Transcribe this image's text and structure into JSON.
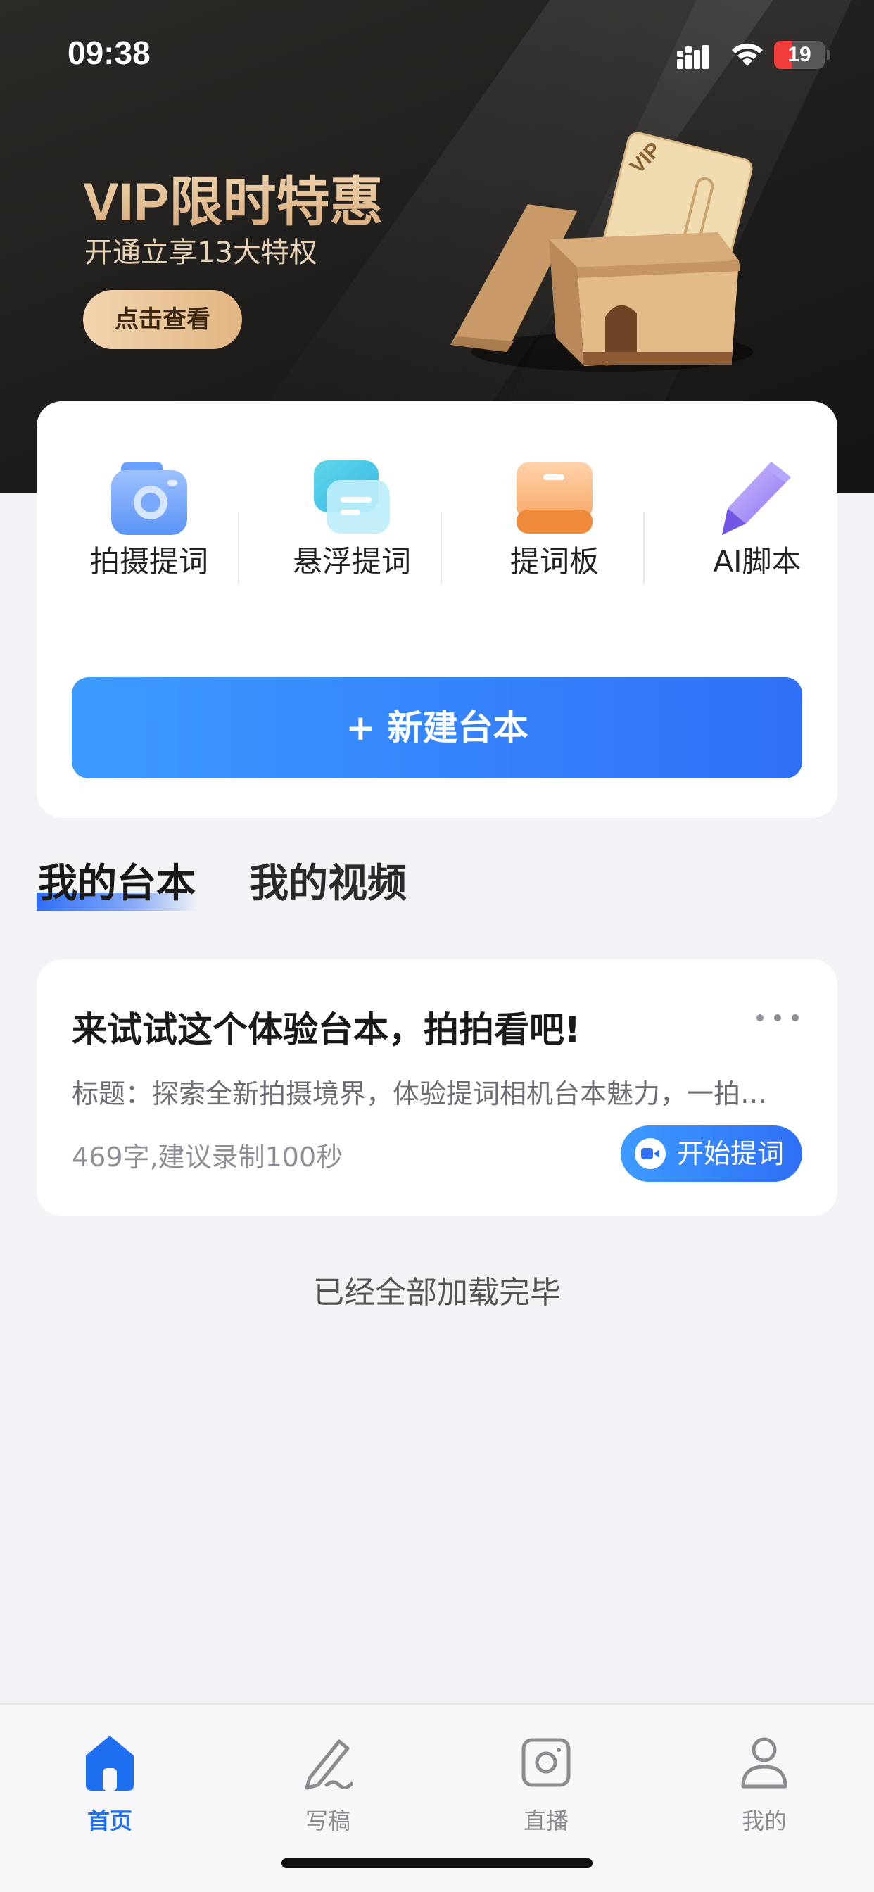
{
  "status_bar": {
    "time": "09:38",
    "battery": "19",
    "battery_level": 0.19
  },
  "promo": {
    "title": "VIP限时特惠",
    "subtitle": "开通立享13大特权",
    "button_label": "点击查看",
    "card_badge": "VIP"
  },
  "tools": [
    {
      "label": "拍摄提词",
      "icon": "camera-icon"
    },
    {
      "label": "悬浮提词",
      "icon": "floating-window-icon"
    },
    {
      "label": "提词板",
      "icon": "board-icon"
    },
    {
      "label": "AI脚本",
      "icon": "pen-icon"
    }
  ],
  "new_script_label": "+ 新建台本",
  "tabs": [
    {
      "label": "我的台本",
      "active": true
    },
    {
      "label": "我的视频",
      "active": false
    }
  ],
  "script": {
    "title": "来试试这个体验台本，拍拍看吧!",
    "description": "标题：探索全新拍摄境界，体验提词相机台本魅力，一拍即合！",
    "meta": "469字,建议录制100秒",
    "start_label": "开始提词"
  },
  "end_text": "已经全部加载完毕",
  "nav": [
    {
      "label": "首页",
      "icon": "home-icon",
      "active": true
    },
    {
      "label": "写稿",
      "icon": "write-icon",
      "active": false
    },
    {
      "label": "直播",
      "icon": "live-icon",
      "active": false
    },
    {
      "label": "我的",
      "icon": "profile-icon",
      "active": false
    }
  ],
  "colors": {
    "accent": "#2f6ff7",
    "accent_light": "#3d9bff",
    "battery_low": "#f23c3c",
    "promo_gold": "#e2b682"
  }
}
